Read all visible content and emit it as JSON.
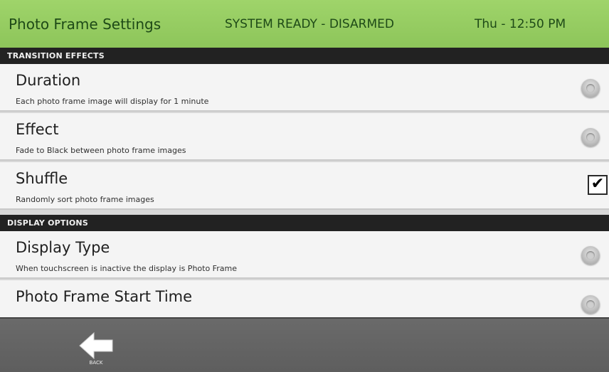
{
  "header": {
    "title": "Photo Frame Settings",
    "status": "SYSTEM READY - DISARMED",
    "clock": "Thu - 12:50 PM",
    "color": "#8dc55a"
  },
  "sections": {
    "transition": "TRANSITION EFFECTS",
    "display": "DISPLAY OPTIONS"
  },
  "rows": [
    {
      "title": "Duration",
      "desc": "Each photo frame image will display for 1 minute",
      "control": "radio"
    },
    {
      "title": "Effect",
      "desc": "Fade to Black between photo frame images",
      "control": "radio"
    },
    {
      "title": "Shuffle",
      "desc": "Randomly sort photo frame images",
      "control": "checkbox",
      "checked": true
    },
    {
      "title": "Display Type",
      "desc": "When touchscreen is inactive the display is Photo Frame",
      "control": "radio"
    },
    {
      "title": "Photo Frame Start Time",
      "desc": "",
      "control": "radio"
    }
  ],
  "footer": {
    "back_label": "BACK",
    "back_icon": "back-arrow-icon"
  }
}
